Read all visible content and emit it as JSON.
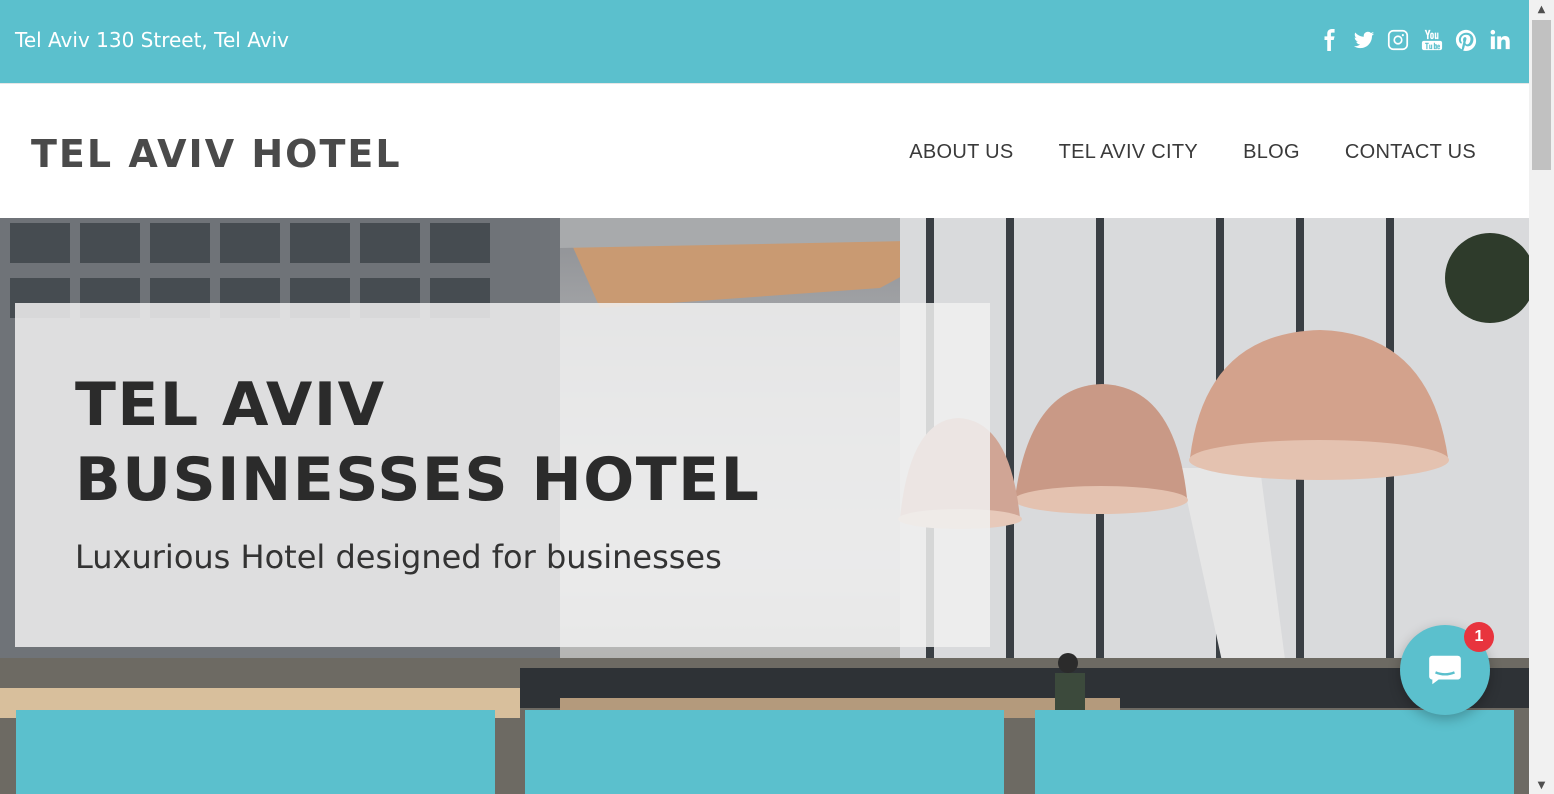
{
  "topbar": {
    "address": "Tel Aviv 130 Street, Tel Aviv",
    "social_icons": [
      "facebook-icon",
      "twitter-icon",
      "instagram-icon",
      "youtube-icon",
      "pinterest-icon",
      "linkedin-icon"
    ]
  },
  "header": {
    "logo": "TEL AVIV HOTEL",
    "nav": [
      "ABOUT US",
      "TEL AVIV CITY",
      "BLOG",
      "CONTACT US"
    ]
  },
  "hero": {
    "title": "TEL AVIV BUSINESSES HOTEL",
    "subtitle": "Luxurious Hotel designed for businesses"
  },
  "chat": {
    "badge": "1"
  },
  "colors": {
    "accent": "#5bc0cd",
    "badge": "#e8343e",
    "text_dark": "#2b2b2b"
  }
}
